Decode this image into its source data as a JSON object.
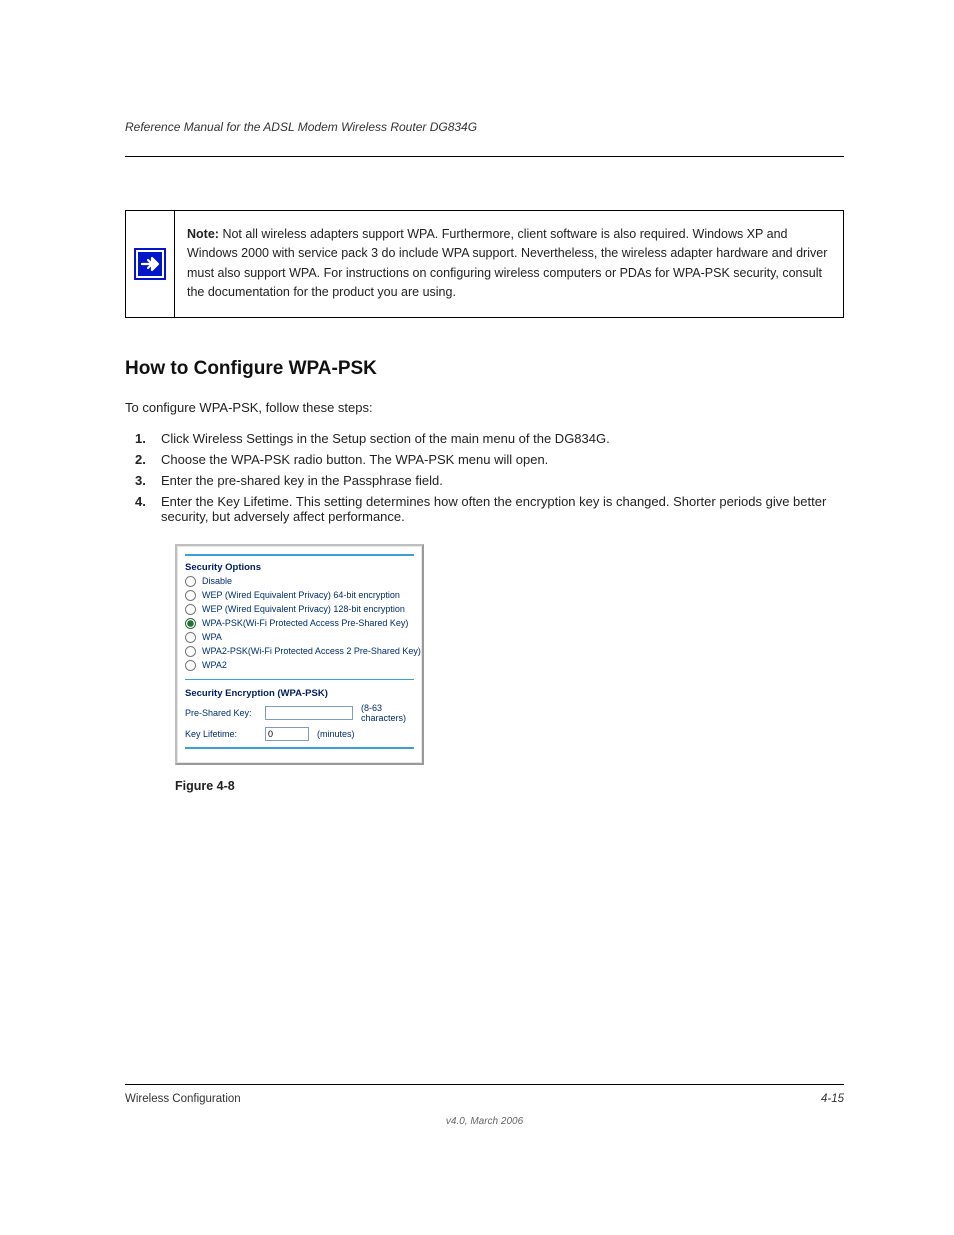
{
  "header": {
    "running_title": "Reference Manual for the ADSL Modem Wireless Router DG834G"
  },
  "note": {
    "text": "Not all wireless adapters support WPA. Furthermore, client software is also required. Windows XP and Windows 2000 with service pack 3 do include WPA support. Nevertheless, the wireless adapter hardware and driver must also support WPA. For instructions on configuring wireless computers or PDAs for WPA-PSK security, consult the documentation for the product you are using.",
    "lead_label": "Note:"
  },
  "body": {
    "title": "How to Configure WPA-PSK",
    "intro": "To configure WPA-PSK, follow these steps:",
    "steps": {
      "s1": {
        "n": "1.",
        "t": "Click Wireless Settings in the Setup section of the main menu of the DG834G."
      },
      "s2": {
        "n": "2.",
        "t": "Choose the WPA-PSK radio button. The WPA-PSK menu will open."
      },
      "s3": {
        "n": "3.",
        "t": "Enter the pre-shared key in the Passphrase field."
      },
      "s4": {
        "n": "4.",
        "t": "Enter the Key Lifetime. This setting determines how often the encryption key is changed. Shorter periods give better security, but adversely affect performance."
      }
    }
  },
  "dialog": {
    "section1_title": "Security Options",
    "options": {
      "o0": "Disable",
      "o1": "WEP (Wired Equivalent Privacy) 64-bit encryption",
      "o2": "WEP (Wired Equivalent Privacy) 128-bit encryption",
      "o3": "WPA-PSK(Wi-Fi Protected Access Pre-Shared Key)",
      "o4": "WPA",
      "o5": "WPA2-PSK(Wi-Fi Protected Access 2 Pre-Shared Key)",
      "o6": "WPA2"
    },
    "section2_title": "Security Encryption (WPA-PSK)",
    "psk_label": "Pre-Shared Key:",
    "psk_value": "",
    "psk_hint": "(8-63 characters)",
    "life_label": "Key Lifetime:",
    "life_value": "0",
    "life_unit": "(minutes)"
  },
  "figure_caption": "Figure 4-8",
  "footer": {
    "left": "Wireless Configuration",
    "right": "4-15",
    "version": "v4.0, March 2006"
  }
}
